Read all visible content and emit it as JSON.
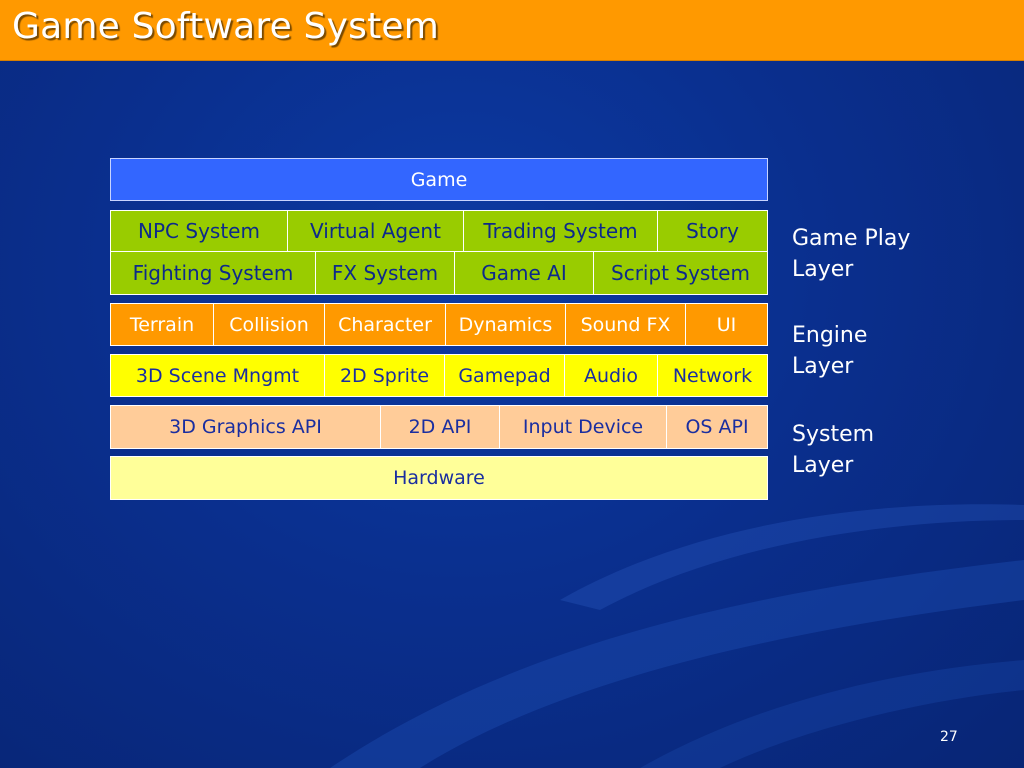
{
  "slide": {
    "title": "Game Software System",
    "page_number": "27",
    "colors": {
      "title_bar": "#ff9900",
      "background": "#0a2f8e",
      "game_row": "#3366ff",
      "game_play_rows": "#99cc00",
      "engine_row": "#ff9900",
      "middleware_row": "#ffff00",
      "system_api_row": "#ffcc99",
      "hardware_row": "#ffff99"
    }
  },
  "diagram": {
    "game": "Game",
    "game_play_row1": [
      "NPC System",
      "Virtual Agent",
      "Trading System",
      "Story"
    ],
    "game_play_row2": [
      "Fighting System",
      "FX System",
      "Game AI",
      "Script System"
    ],
    "engine_row": [
      "Terrain",
      "Collision",
      "Character",
      "Dynamics",
      "Sound FX",
      "UI"
    ],
    "middleware_row": [
      "3D Scene Mngmt",
      "2D Sprite",
      "Gamepad",
      "Audio",
      "Network"
    ],
    "system_row": [
      "3D Graphics API",
      "2D API",
      "Input Device",
      "OS API"
    ],
    "hardware": "Hardware"
  },
  "layers": {
    "game_play": [
      "Game Play",
      "Layer"
    ],
    "engine": [
      "Engine",
      "Layer"
    ],
    "system": [
      "System",
      "Layer"
    ]
  }
}
